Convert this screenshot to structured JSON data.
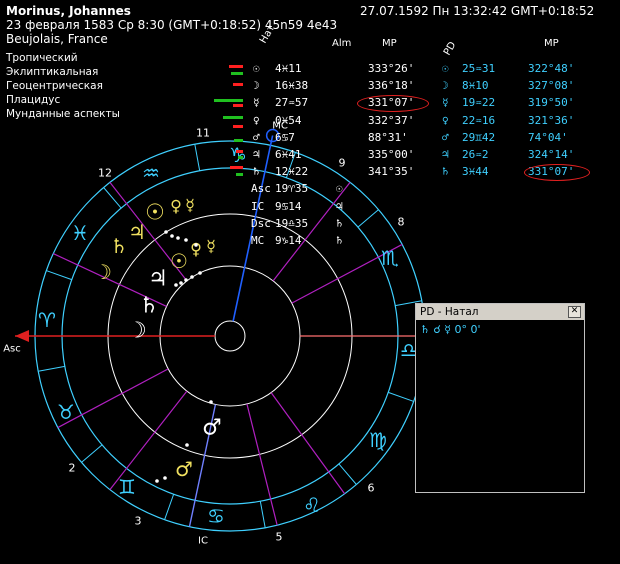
{
  "header": {
    "name": "Morinus, Johannes",
    "date_line": "23 февраля 1583  Ср   8:30 (GMT+0:18:52) 45n59  4e43",
    "place": "Beujolais, France",
    "current_datetime": "27.07.1592   Пн 13:32:42 GMT+0:18:52"
  },
  "options": [
    "Тропический",
    "Эклиптикальная",
    "Геоцентрическая",
    "Плацидус",
    "Мунданные аспекты"
  ],
  "table": {
    "headers": {
      "nat": "Нат",
      "alm": "Alm",
      "mp": "MP",
      "pd": "PD",
      "mp2": "MP"
    },
    "rows": [
      {
        "glyph": "☉",
        "pos": "4♓11",
        "mp": "333°26'",
        "pd_glyph": "☉",
        "pd_pos": "25♒31",
        "pd_mp": "322°48'"
      },
      {
        "glyph": "☽",
        "pos": "16♓38",
        "mp": "336°18'",
        "pd_glyph": "☽",
        "pd_pos": "8♓10",
        "pd_mp": "327°08'"
      },
      {
        "glyph": "☿",
        "pos": "27♒57",
        "mp": "331°07'",
        "pd_glyph": "☿",
        "pd_pos": "19♒22",
        "pd_mp": "319°50'"
      },
      {
        "glyph": "♀",
        "pos": "0♓54",
        "mp": "332°37'",
        "pd_glyph": "♀",
        "pd_pos": "22♒16",
        "pd_mp": "321°36'"
      },
      {
        "glyph": "♂",
        "pos": "6♋7",
        "mp": "88°31'",
        "pd_glyph": "♂",
        "pd_pos": "29♊42",
        "pd_mp": "74°04'"
      },
      {
        "glyph": "♃",
        "pos": "6♓41",
        "mp": "335°00'",
        "pd_glyph": "♃",
        "pd_pos": "26♒2",
        "pd_mp": "324°14'"
      },
      {
        "glyph": "♄",
        "pos": "12♓22",
        "mp": "341°35'",
        "pd_glyph": "♄",
        "pd_pos": "3♓44",
        "pd_mp": "331°07'"
      },
      {
        "glyph": "Asc",
        "pos": "19♈35",
        "mp": "☉",
        "pd_glyph": "",
        "pd_pos": "",
        "pd_mp": ""
      },
      {
        "glyph": "IC",
        "pos": "9♋14",
        "mp": "♃",
        "pd_glyph": "",
        "pd_pos": "",
        "pd_mp": ""
      },
      {
        "glyph": "Dsc",
        "pos": "19♎35",
        "mp": "♄",
        "pd_glyph": "",
        "pd_pos": "",
        "pd_mp": ""
      },
      {
        "glyph": "MC",
        "pos": "9♑14",
        "mp": "♄",
        "pd_glyph": "",
        "pd_pos": "",
        "pd_mp": ""
      }
    ]
  },
  "chart": {
    "asc_label": "Asc",
    "ic_label": "IC",
    "mc_label": "MC",
    "house_numbers": [
      "11",
      "12",
      "9",
      "8",
      "2",
      "3",
      "5",
      "6"
    ],
    "signs": [
      "♑",
      "♒",
      "♓",
      "♈",
      "♉",
      "♊",
      "♋",
      "♌",
      "♍",
      "♎",
      "♏"
    ],
    "outer_planets": [
      "☉",
      "♀",
      "☿",
      "♃",
      "♄",
      "☽",
      "☉",
      "♀",
      "☿",
      "♂"
    ],
    "inner_planets": [
      "♃",
      "♄",
      "☽",
      "♂"
    ]
  },
  "pd_window": {
    "title": "PD - Натал",
    "close": "✕",
    "line": "♄ ☌ ☿          0° 0'"
  },
  "colors": {
    "ring": "#3fd0ff",
    "house_line": "#b020c0",
    "asc_line": "#e02020",
    "mc_line": "#2060ff",
    "yellow": "#f0e060",
    "cyan_text": "#3fd0ff",
    "red_oval": "#e02020"
  }
}
